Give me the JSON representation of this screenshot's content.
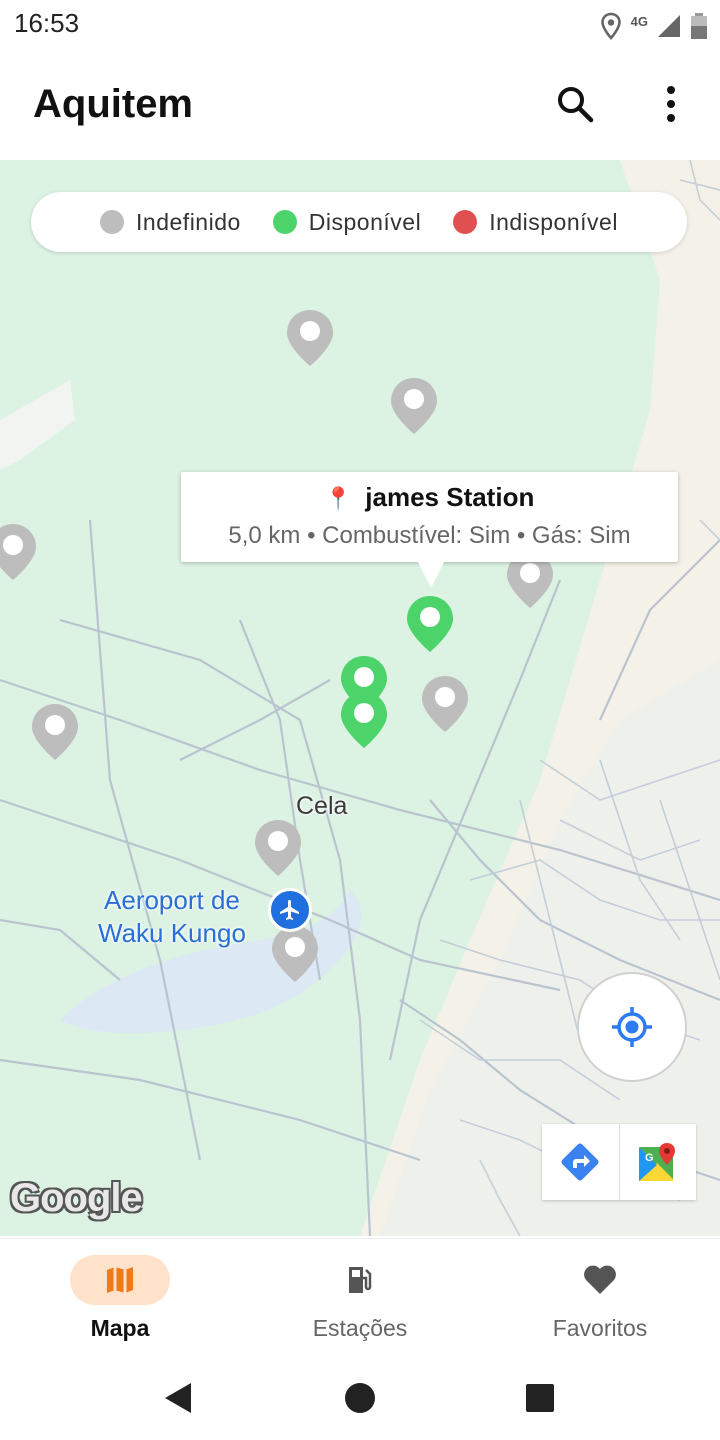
{
  "status_bar": {
    "time": "16:53",
    "network": "4G"
  },
  "app_bar": {
    "title": "Aquitem",
    "icons": [
      "search-icon",
      "more-vert-icon"
    ]
  },
  "legend": [
    {
      "label": "Indefinido",
      "color": "#bdbdbd"
    },
    {
      "label": "Disponível",
      "color": "#4cd46b"
    },
    {
      "label": "Indisponível",
      "color": "#e05050"
    }
  ],
  "info_window": {
    "title": "james Station",
    "icon": "📍",
    "details": "5,0 km • Combustível: Sim • Gás: Sim"
  },
  "map_labels": {
    "town": "Cela",
    "airport": "Aeroport de\nWaku Kungo",
    "attribution": "Google"
  },
  "colors": {
    "available": "#4cd46b",
    "undefined": "#bdbdbd",
    "unavailable": "#e05050",
    "accent": "#1f6fe0",
    "nav_active": "#ffe2c9",
    "nav_active_icon": "#f07a1a"
  },
  "bottom_nav": [
    {
      "label": "Mapa",
      "icon": "map-icon",
      "active": true
    },
    {
      "label": "Estações",
      "icon": "gas-station-icon",
      "active": false
    },
    {
      "label": "Favoritos",
      "icon": "heart-icon",
      "active": false
    }
  ],
  "system_nav": [
    "back-icon",
    "home-icon",
    "recents-icon"
  ]
}
